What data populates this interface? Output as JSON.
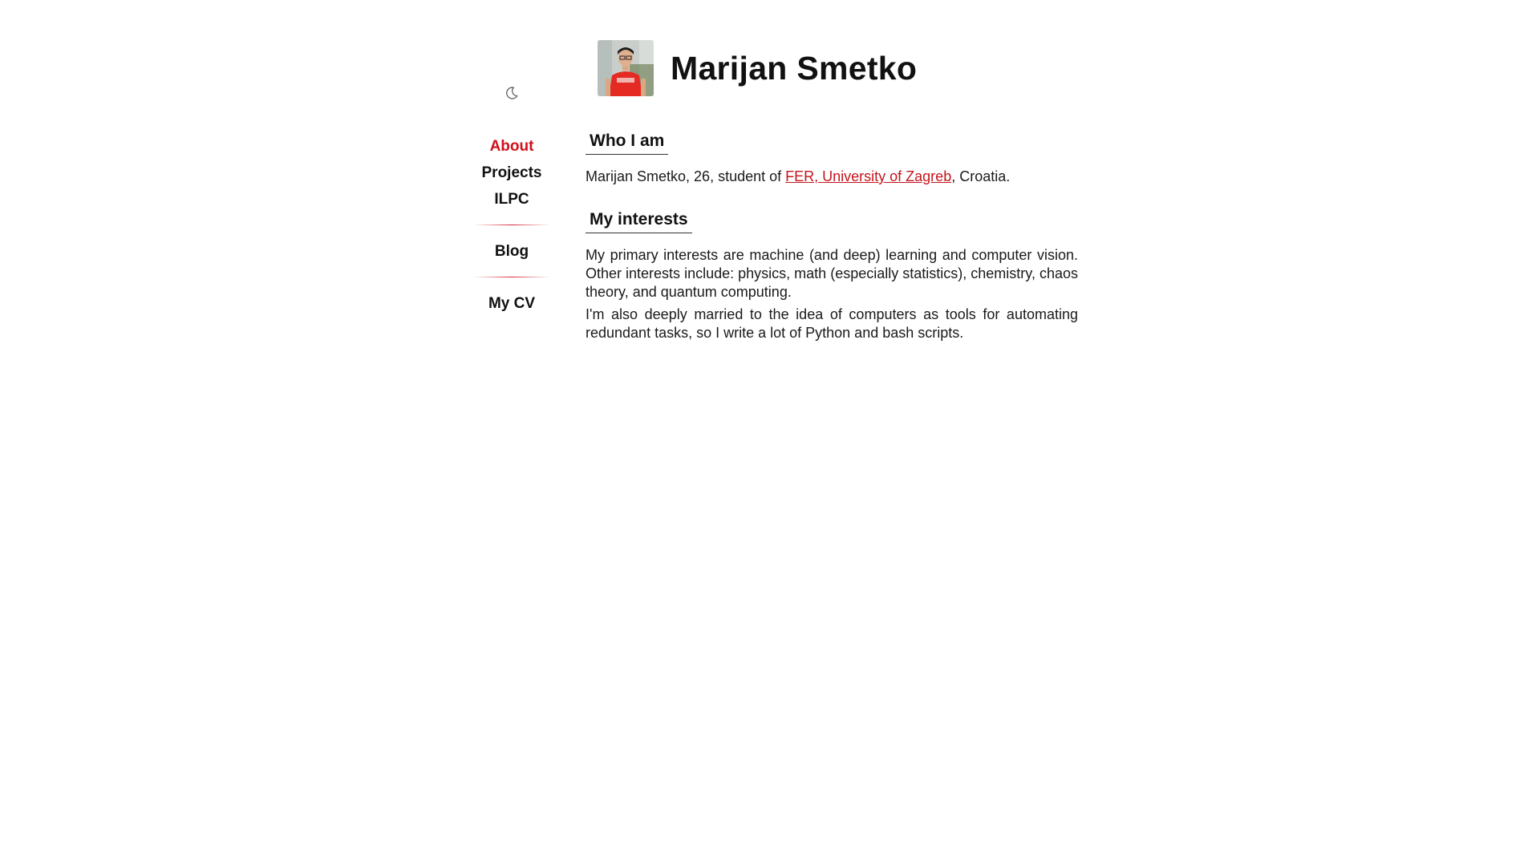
{
  "header": {
    "title": "Marijan Smetko",
    "avatar_icon": "profile-photo"
  },
  "theme_toggle": {
    "icon": "moon-icon"
  },
  "sidebar": {
    "items": [
      {
        "label": "About",
        "active": true
      },
      {
        "label": "Projects",
        "active": false
      },
      {
        "label": "ILPC",
        "active": false
      },
      {
        "label": "Blog",
        "active": false
      },
      {
        "label": "My CV",
        "active": false
      }
    ]
  },
  "main": {
    "who_i_am": {
      "heading": "Who I am",
      "text_before": "Marijan Smetko, 26, student of ",
      "link_text": "FER, University of Zagreb",
      "text_after": ", Croatia."
    },
    "interests": {
      "heading": "My interests",
      "paragraph1": "My primary interests are machine (and deep) learning and computer vision. Other interests include: physics, math (especially statistics), chemistry, chaos theory, and quantum computing.",
      "paragraph2": "I'm also deeply married to the idea of computers as tools for automating redundant tasks, so I write a lot of Python and bash scripts."
    }
  },
  "colors": {
    "accent": "#d4101a",
    "link": "#c4141c",
    "text": "#111111",
    "background": "#ffffff"
  }
}
